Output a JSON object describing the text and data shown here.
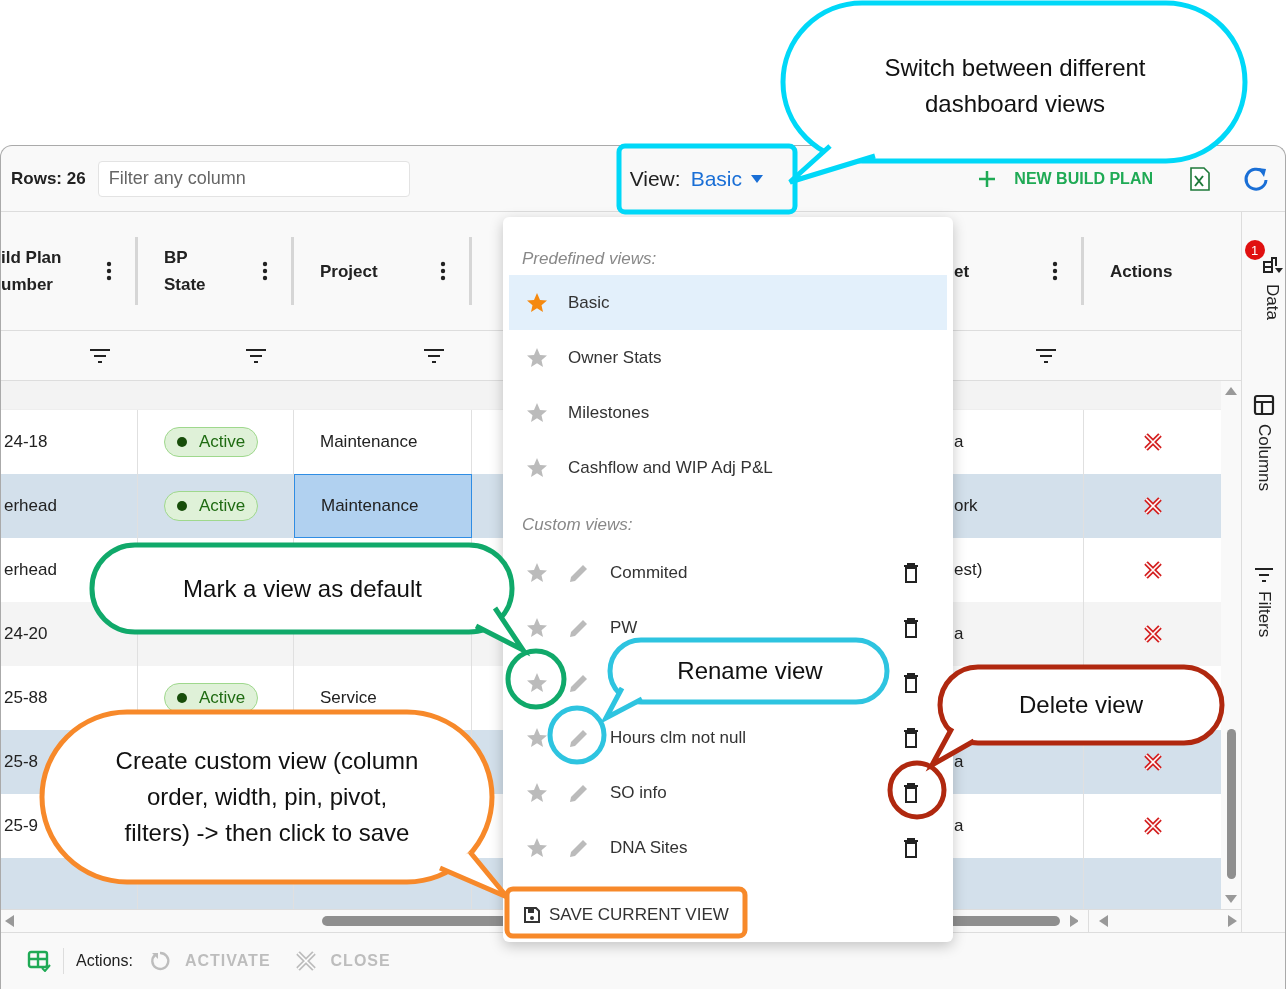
{
  "toolbar": {
    "rows_label": "Rows: 26",
    "filter_placeholder": "Filter any column",
    "view_label": "View:",
    "view_value": "Basic",
    "new_button": "NEW BUILD PLAN"
  },
  "columns": [
    {
      "label": "ild Plan umber",
      "filterable": true
    },
    {
      "label": "BP State",
      "filterable": true
    },
    {
      "label": "Project",
      "filterable": true
    },
    {
      "label": "et",
      "filterable": true
    },
    {
      "label": "Actions",
      "filterable": false
    }
  ],
  "rows": [
    {
      "build_plan_number": "24-18",
      "bp_state": "Active",
      "project": "Maintenance",
      "column_5": "a",
      "delete_action": true,
      "selected": false
    },
    {
      "build_plan_number": "erhead",
      "bp_state": "Active",
      "project": "Maintenance",
      "column_5": "ork",
      "delete_action": true,
      "selected": true,
      "project_focused": true
    },
    {
      "build_plan_number": "erhead",
      "column_5": "est)",
      "delete_action": true,
      "selected": false
    },
    {
      "build_plan_number": "24-20",
      "column_5": "a",
      "delete_action": true,
      "selected": false
    },
    {
      "build_plan_number": "25-88",
      "bp_state": "Active",
      "project": "Service",
      "delete_action": false,
      "selected": false
    },
    {
      "build_plan_number": "25-8",
      "column_5": "a",
      "delete_action": true,
      "selected": true
    },
    {
      "build_plan_number": "25-9",
      "column_5": "a",
      "delete_action": true,
      "selected": false
    },
    {
      "delete_action": false,
      "selected": true
    }
  ],
  "view_menu": {
    "predefined_label": "Predefined views:",
    "predefined": [
      {
        "name": "Basic",
        "default": true,
        "selected": true
      },
      {
        "name": "Owner Stats",
        "default": false,
        "selected": false
      },
      {
        "name": "Milestones",
        "default": false,
        "selected": false
      },
      {
        "name": "Cashflow and WIP Adj P&L",
        "default": false,
        "selected": false
      }
    ],
    "custom_label": "Custom views:",
    "custom": [
      {
        "name": "Commited",
        "default": false
      },
      {
        "name": "PW",
        "default": false
      },
      {
        "default": false
      },
      {
        "name": "Hours clm not null",
        "default": false
      },
      {
        "name": "SO info",
        "default": false
      },
      {
        "name": "DNA Sites",
        "default": false
      }
    ],
    "save_button": "SAVE CURRENT VIEW"
  },
  "side_tabs": [
    {
      "label": "Data",
      "kind": "data",
      "badge": "1"
    },
    {
      "label": "Columns",
      "kind": "columns"
    },
    {
      "label": "Filters",
      "kind": "filters"
    }
  ],
  "footer": {
    "actions_label": "Actions:",
    "buttons": [
      {
        "label": "ACTIVATE",
        "kind": "activate",
        "disabled": true
      },
      {
        "label": "CLOSE",
        "kind": "close",
        "disabled": true
      }
    ]
  },
  "callouts": [
    {
      "text": "Switch between different\ndashboard views",
      "color": "#00d8f8"
    },
    {
      "text": "Mark a view as default",
      "color": "#10a96a"
    },
    {
      "text": "Rename view",
      "color": "#2ec4e0"
    },
    {
      "text": "Delete view",
      "color": "#b0280f"
    },
    {
      "text": "Create custom view (column\norder, width, pin, pivot,\nfilters) -> then click to save",
      "color": "#f7892a"
    }
  ],
  "highlights": [
    {
      "kind": "frame",
      "color": "#00d8f8"
    },
    {
      "kind": "ring",
      "color": "#10a96a"
    },
    {
      "kind": "ring",
      "color": "#2ec4e0"
    },
    {
      "kind": "ring",
      "color": "#b0280f"
    },
    {
      "kind": "frame",
      "color": "#f7892a"
    }
  ]
}
